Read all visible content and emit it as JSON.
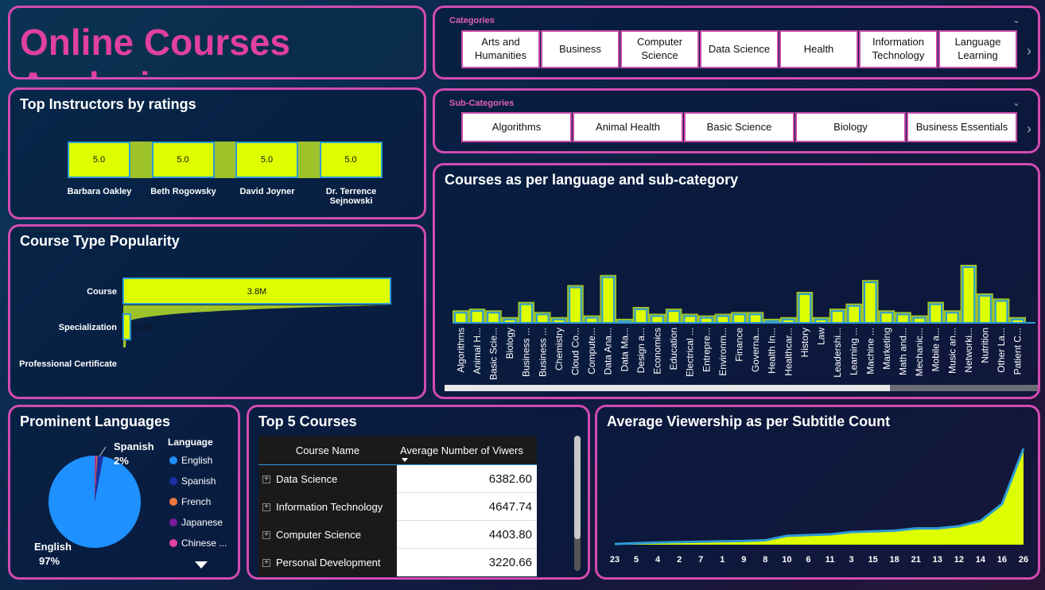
{
  "title": "Online Courses Analysis",
  "categories": {
    "label": "Categories",
    "items": [
      "Arts and Humanities",
      "Business",
      "Computer Science",
      "Data Science",
      "Health",
      "Information Technology",
      "Language Learning"
    ]
  },
  "subcategories": {
    "label": "Sub-Categories",
    "items": [
      "Algorithms",
      "Animal Health",
      "Basic Science",
      "Biology",
      "Business Essentials"
    ]
  },
  "instructors": {
    "title": "Top Instructors by ratings",
    "chart_data": {
      "type": "bar",
      "categories": [
        "Barbara Oakley",
        "Beth Rogowsky",
        "David Joyner",
        "Dr. Terrence Sejnowski"
      ],
      "values": [
        5.0,
        5.0,
        5.0,
        5.0
      ],
      "labels": [
        "5.0",
        "5.0",
        "5.0",
        "5.0"
      ]
    }
  },
  "course_type": {
    "title": "Course Type Popularity",
    "chart_data": {
      "type": "bar",
      "categories": [
        "Course",
        "Specialization",
        "Professional Certificate"
      ],
      "values": [
        3.8,
        0.1,
        0
      ],
      "labels": [
        "3.8M",
        "0.1M",
        ""
      ]
    }
  },
  "language_subcat": {
    "title": "Courses as per language and sub-category",
    "chart_data": {
      "type": "bar",
      "categories": [
        "Algorithms",
        "Animal H...",
        "Basic Scie...",
        "Biology",
        "Business ...",
        "Business ...",
        "Chemistry",
        "Cloud Co...",
        "Compute...",
        "Data Ana...",
        "Data Ma...",
        "Design a...",
        "Economics",
        "Education",
        "Electrical ...",
        "Entrepre...",
        "Environm...",
        "Finance",
        "Governa...",
        "Health In...",
        "Healthcar...",
        "History",
        "Law",
        "Leadershi...",
        "Learning ...",
        "Machine ...",
        "Marketing",
        "Math and...",
        "Mechanic...",
        "Mobile a...",
        "Music an...",
        "Networki...",
        "Nutrition",
        "Other La...",
        "Patient C..."
      ],
      "values": [
        6,
        7,
        6,
        2,
        11,
        5,
        2,
        21,
        3,
        27,
        1,
        8,
        4,
        7,
        4,
        3,
        4,
        5,
        5,
        1,
        2,
        17,
        2,
        7,
        10,
        24,
        6,
        5,
        3,
        11,
        6,
        33,
        16,
        13,
        2
      ]
    }
  },
  "languages": {
    "title": "Prominent Languages",
    "legend_title": "Language",
    "chart_data": {
      "type": "pie",
      "labels": [
        "English",
        "Spanish",
        "French",
        "Japanese",
        "Chinese ..."
      ],
      "values": [
        97,
        2,
        0.4,
        0.3,
        0.3
      ],
      "colors": [
        "#1e90ff",
        "#1a2fa8",
        "#f07840",
        "#7a1a9a",
        "#e040a0"
      ]
    },
    "english_label": "English",
    "english_pct": "97%",
    "spanish_label": "Spanish",
    "spanish_pct": "2%"
  },
  "top_courses": {
    "title": "Top 5 Courses",
    "col_name": "Course Name",
    "col_value": "Average Number of Viwers",
    "rows": [
      {
        "name": "Data Science",
        "value": "6382.60"
      },
      {
        "name": "Information Technology",
        "value": "4647.74"
      },
      {
        "name": "Computer Science",
        "value": "4403.80"
      },
      {
        "name": "Personal Development",
        "value": "3220.66"
      }
    ]
  },
  "viewership": {
    "title": "Average Viewership as per Subtitle Count",
    "chart_data": {
      "type": "area",
      "x": [
        "23",
        "5",
        "4",
        "2",
        "7",
        "1",
        "9",
        "8",
        "10",
        "6",
        "11",
        "3",
        "15",
        "18",
        "21",
        "13",
        "12",
        "14",
        "16",
        "26"
      ],
      "values": [
        1,
        2,
        3,
        3.5,
        4,
        4.5,
        5,
        6,
        12,
        13,
        14,
        17,
        18,
        19,
        22,
        22,
        25,
        32,
        55,
        130
      ]
    }
  }
}
